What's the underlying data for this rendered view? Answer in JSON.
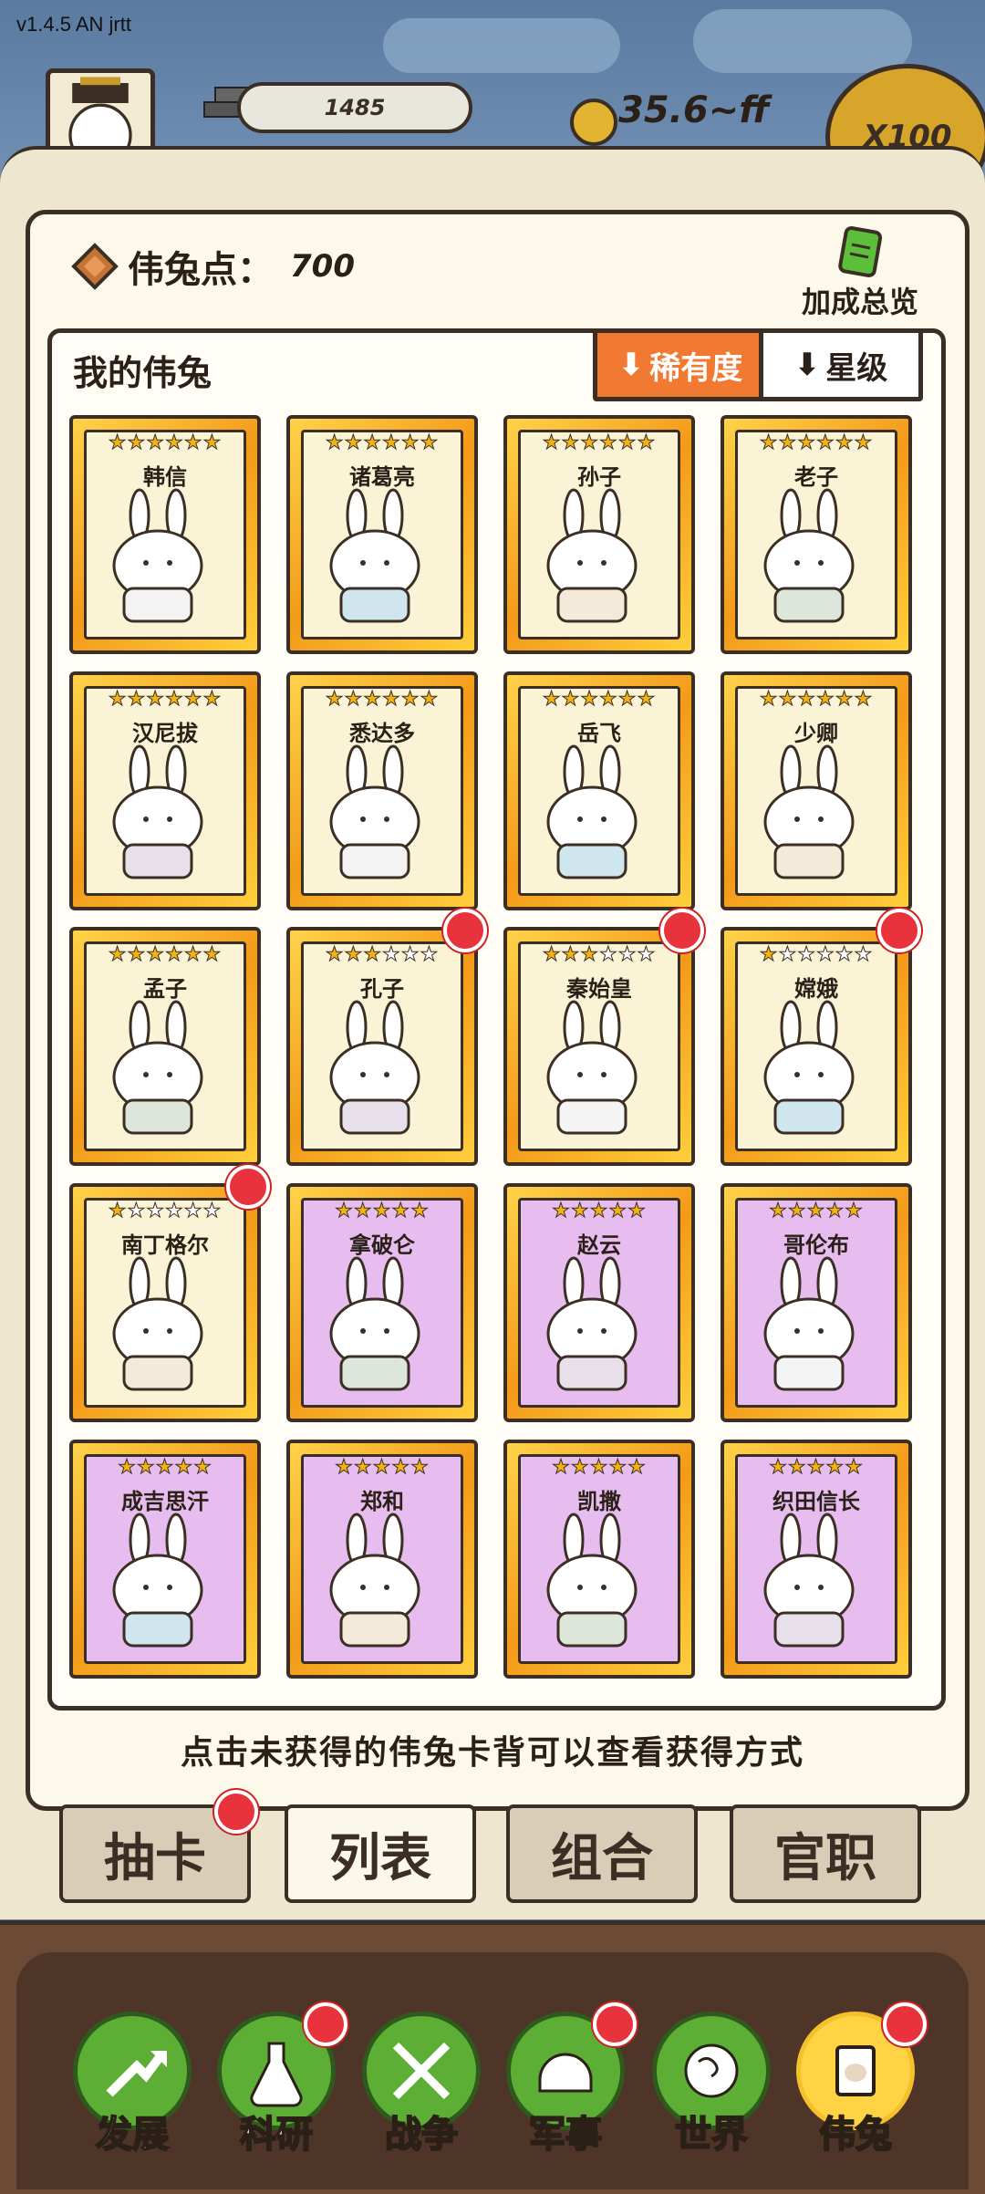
{
  "version": "v1.4.5 AN jrtt",
  "top_bar": {
    "resource_amount": "1485",
    "coin_amount": "35.6~ff",
    "multiplier": "X100"
  },
  "panel": {
    "points_label": "伟兔点：",
    "points_value": "700",
    "bonus_label": "加成总览",
    "list_title": "我的伟兔",
    "sort_rarity": "稀有度",
    "sort_star": "星级",
    "hint": "点击未获得的伟兔卡背可以查看获得方式"
  },
  "cards": [
    {
      "name": "韩信",
      "stars": 6,
      "frame": "gold",
      "dot": false
    },
    {
      "name": "诸葛亮",
      "stars": 6,
      "frame": "gold",
      "dot": false
    },
    {
      "name": "孙子",
      "stars": 6,
      "frame": "gold",
      "dot": false
    },
    {
      "name": "老子",
      "stars": 6,
      "frame": "gold",
      "dot": false
    },
    {
      "name": "汉尼拔",
      "stars": 6,
      "frame": "gold",
      "dot": false
    },
    {
      "name": "悉达多",
      "stars": 6,
      "frame": "gold",
      "dot": false
    },
    {
      "name": "岳飞",
      "stars": 6,
      "frame": "gold",
      "dot": false
    },
    {
      "name": "少卿",
      "stars": 6,
      "frame": "gold",
      "dot": false
    },
    {
      "name": "孟子",
      "stars": 6,
      "frame": "gold",
      "dot": false
    },
    {
      "name": "孔子",
      "stars": 3,
      "frame": "gold",
      "dot": true
    },
    {
      "name": "秦始皇",
      "stars": 3,
      "frame": "gold",
      "dot": true
    },
    {
      "name": "嫦娥",
      "stars": 1,
      "frame": "gold",
      "dot": true
    },
    {
      "name": "南丁格尔",
      "stars": 1,
      "frame": "gold",
      "dot": true
    },
    {
      "name": "拿破仑",
      "stars": 5,
      "frame": "purple",
      "dot": false
    },
    {
      "name": "赵云",
      "stars": 5,
      "frame": "purple",
      "dot": false
    },
    {
      "name": "哥伦布",
      "stars": 5,
      "frame": "purple",
      "dot": false
    },
    {
      "name": "成吉思汗",
      "stars": 5,
      "frame": "purple",
      "dot": false
    },
    {
      "name": "郑和",
      "stars": 5,
      "frame": "purple",
      "dot": false
    },
    {
      "name": "凯撒",
      "stars": 5,
      "frame": "purple",
      "dot": false
    },
    {
      "name": "织田信长",
      "stars": 5,
      "frame": "purple",
      "dot": false
    }
  ],
  "tabs": [
    {
      "label": "抽卡",
      "active": false,
      "dot": true
    },
    {
      "label": "列表",
      "active": true,
      "dot": false
    },
    {
      "label": "组合",
      "active": false,
      "dot": false
    },
    {
      "label": "官职",
      "active": false,
      "dot": false
    }
  ],
  "nav": [
    {
      "label": "发展",
      "icon": "growth-arrow-icon",
      "dot": false,
      "active": false
    },
    {
      "label": "科研",
      "icon": "flask-icon",
      "dot": true,
      "active": false
    },
    {
      "label": "战争",
      "icon": "crossed-swords-icon",
      "dot": false,
      "active": false
    },
    {
      "label": "军事",
      "icon": "helmet-icon",
      "dot": true,
      "active": false
    },
    {
      "label": "世界",
      "icon": "globe-icon",
      "dot": false,
      "active": false
    },
    {
      "label": "伟兔",
      "icon": "rabbit-card-icon",
      "dot": true,
      "active": true
    }
  ],
  "colors": {
    "outline": "#3b2f25",
    "gold_frame": "#f39a1a",
    "purple_card": "#e7bdf0",
    "sort_active": "#f17932",
    "nav_green": "#5cae35",
    "nav_active": "#ffd344",
    "badge_red": "#e8323c"
  }
}
